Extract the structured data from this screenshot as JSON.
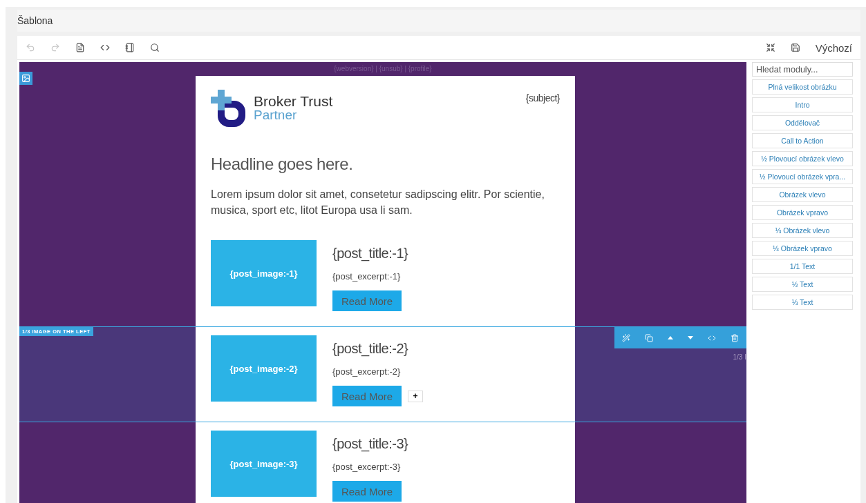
{
  "panel": {
    "title": "Šablona"
  },
  "toolbar": {
    "tools": [
      {
        "kind": "undo",
        "disabled": true
      },
      {
        "kind": "redo",
        "disabled": true
      },
      {
        "kind": "document",
        "disabled": false
      },
      {
        "kind": "code",
        "disabled": false
      },
      {
        "kind": "list",
        "disabled": false
      },
      {
        "kind": "search",
        "disabled": false
      }
    ],
    "right_tools": [
      {
        "kind": "fullscreen"
      },
      {
        "kind": "save"
      }
    ],
    "label": "Výchozí"
  },
  "email": {
    "top_links": "{webversion} | {unsub} | {profile}",
    "logo": {
      "line_1": "Broker Trust",
      "line_2": "Partner"
    },
    "subject": "{subject}",
    "headline": "Headline goes here.",
    "intro": "Lorem ipsum dolor sit amet, consetetur sadipscing elitr. Por scientie, musica, sport etc, litot Europa usa li sam."
  },
  "posts": [
    {
      "image": "{post_image:-1}",
      "title": "{post_title:-1}",
      "excerpt": "{post_excerpt:-1}",
      "button": "Read More",
      "selected": false
    },
    {
      "image": "{post_image:-2}",
      "title": "{post_title:-2}",
      "excerpt": "{post_excerpt:-2}",
      "button": "Read More",
      "selected": true
    },
    {
      "image": "{post_image:-3}",
      "title": "{post_title:-3}",
      "excerpt": "{post_excerpt:-3}",
      "button": "Read More",
      "selected": false
    }
  ],
  "selection": {
    "label": "1/3 IMAGE ON THE LEFT",
    "side_text": "1/3 I",
    "add_button": "+",
    "tools": [
      {
        "kind": "wand"
      },
      {
        "kind": "copy"
      },
      {
        "kind": "up"
      },
      {
        "kind": "down"
      },
      {
        "kind": "code"
      },
      {
        "kind": "delete"
      }
    ]
  },
  "sidebar": {
    "search_placeholder": "Hledat moduly...",
    "modules": [
      "Plná velikost obrázku",
      "Intro",
      "Oddělovač",
      "Call to Action",
      "½ Plovoucí obrázek vlevo",
      "½ Plovoucí obrázek vpra...",
      "Obrázek vlevo",
      "Obrázek vpravo",
      "⅓ Obrázek vlevo",
      "⅓ Obrázek vpravo",
      "1/1 Text",
      "½ Text",
      "⅓ Text"
    ]
  }
}
